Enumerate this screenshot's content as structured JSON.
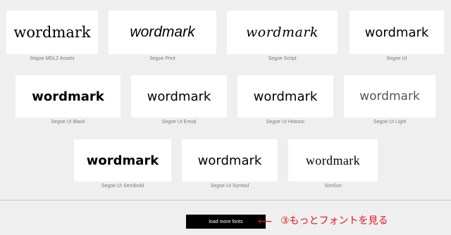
{
  "fonts": [
    {
      "name": "Segoe MDL2 Assets",
      "sample": "wordmark"
    },
    {
      "name": "Segoe Print",
      "sample": "wordmark"
    },
    {
      "name": "Segoe Script",
      "sample": "wordmark"
    },
    {
      "name": "Segoe UI",
      "sample": "wordmark"
    },
    {
      "name": "Segoe UI Black",
      "sample": "wordmark"
    },
    {
      "name": "Segoe UI Emoji",
      "sample": "wordmark"
    },
    {
      "name": "Segoe UI Historic",
      "sample": "wordmark"
    },
    {
      "name": "Segoe UI Light",
      "sample": "wordmark"
    },
    {
      "name": "Segoe UI Semibold",
      "sample": "wordmark"
    },
    {
      "name": "Segoe UI Symbol",
      "sample": "wordmark"
    },
    {
      "name": "SimSun",
      "sample": "wordmark"
    }
  ],
  "load_more": {
    "label": "load more fonts"
  },
  "annotation": {
    "arrow": "⟵",
    "text": "③もっとフォントを見る",
    "color": "#e0151b"
  }
}
